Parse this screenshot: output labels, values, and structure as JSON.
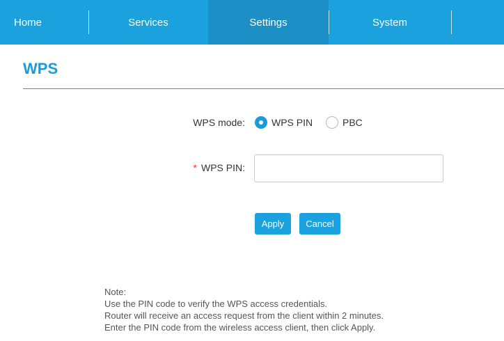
{
  "nav": {
    "items": [
      {
        "label": "Home"
      },
      {
        "label": "Services"
      },
      {
        "label": "Settings",
        "active": true
      },
      {
        "label": "System"
      }
    ]
  },
  "page": {
    "title": "WPS"
  },
  "form": {
    "mode_label": "WPS mode:",
    "mode_options": [
      {
        "label": "WPS PIN",
        "selected": true
      },
      {
        "label": "PBC",
        "selected": false
      }
    ],
    "required_marker": "*",
    "pin_label": "WPS PIN:",
    "pin_value": "",
    "apply_label": "Apply",
    "cancel_label": "Cancel"
  },
  "note": {
    "heading": "Note:",
    "lines": [
      "Use the PIN code to verify the WPS access credentials.",
      "Router will receive an access request from the client within 2 minutes.",
      "Enter the PIN code from the wireless access client, then click Apply."
    ]
  },
  "colors": {
    "nav_bg": "#1ba1dd",
    "nav_active": "#1b8fc6",
    "accent": "#1b9bd8",
    "required": "#e03a3a"
  }
}
